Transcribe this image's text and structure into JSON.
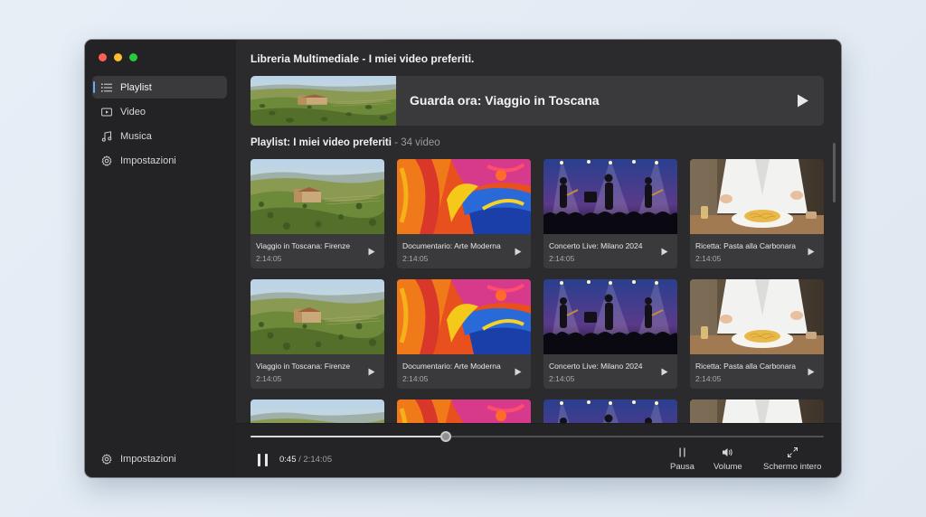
{
  "app_title": "Libreria Multimediale - I miei video preferiti.",
  "sidebar": {
    "items": [
      {
        "label": "Playlist",
        "icon": "list-icon",
        "active": true
      },
      {
        "label": "Video",
        "icon": "video-icon"
      },
      {
        "label": "Musica",
        "icon": "music-icon"
      },
      {
        "label": "Impostazioni",
        "icon": "gear-icon"
      }
    ],
    "bottom_item": {
      "label": "Impostazioni",
      "icon": "gear-icon"
    }
  },
  "hero": {
    "title": "Guarda ora: Viaggio in Toscana",
    "thumbnail": "tuscany-landscape",
    "icon": "play-icon"
  },
  "playlist": {
    "title": "Playlist: I miei video preferiti",
    "separator": " - ",
    "count": "34 video"
  },
  "videos": [
    {
      "title": "Viaggio in Toscana: Firenze",
      "duration": "2:14:05",
      "thumbnail": "tuscany-landscape"
    },
    {
      "title": "Documentario: Arte Moderna",
      "duration": "2:14:05",
      "thumbnail": "abstract-painting"
    },
    {
      "title": "Concerto Live: Milano 2024",
      "duration": "2:14:05",
      "thumbnail": "concert-stage"
    },
    {
      "title": "Ricetta: Pasta alla Carbonara",
      "duration": "2:14:05",
      "thumbnail": "chef-pasta"
    },
    {
      "title": "Viaggio in Toscana: Firenze",
      "duration": "2:14:05",
      "thumbnail": "tuscany-landscape"
    },
    {
      "title": "Documentario: Arte Moderna",
      "duration": "2:14:05",
      "thumbnail": "abstract-painting"
    },
    {
      "title": "Concerto Live: Milano 2024",
      "duration": "2:14:05",
      "thumbnail": "concert-stage"
    },
    {
      "title": "Ricetta: Pasta alla Carbonara",
      "duration": "2:14:05",
      "thumbnail": "chef-pasta"
    },
    {
      "title": "",
      "duration": "",
      "thumbnail": "tuscany-landscape"
    },
    {
      "title": "",
      "duration": "",
      "thumbnail": "abstract-painting"
    },
    {
      "title": "",
      "duration": "",
      "thumbnail": "concert-stage"
    },
    {
      "title": "",
      "duration": "",
      "thumbnail": "chef-pasta"
    }
  ],
  "player": {
    "current_time": "0:45",
    "separator": " / ",
    "total_time": "2:14:05",
    "progress_fraction": 0.34,
    "controls": [
      {
        "label": "Pausa",
        "icon": "pause-icon"
      },
      {
        "label": "Volume",
        "icon": "volume-icon"
      },
      {
        "label": "Schermo intero",
        "icon": "fullscreen-icon"
      }
    ]
  },
  "colors": {
    "accent": "#6aa6ff",
    "window_bg": "#2a2a2c",
    "sidebar_bg": "#232325",
    "card_bg": "#3a3a3c"
  }
}
